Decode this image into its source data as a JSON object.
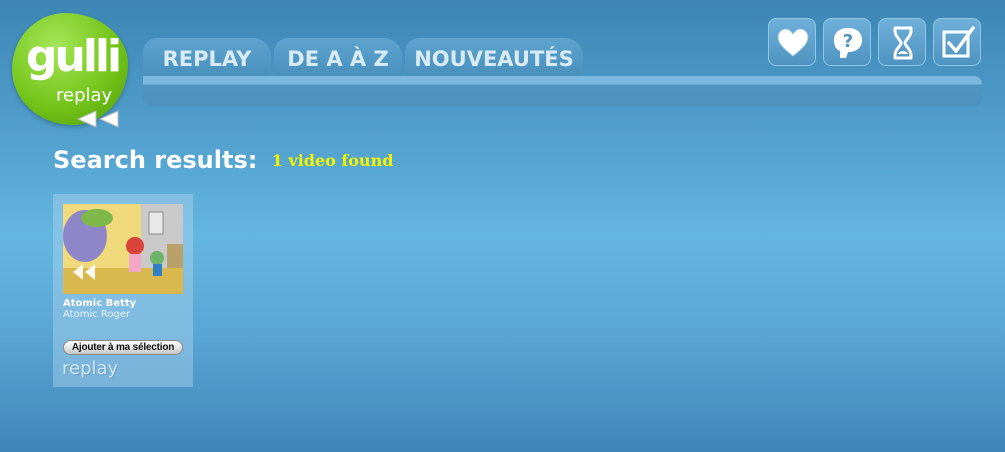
{
  "logo": {
    "main": "gulli",
    "sub": "replay"
  },
  "tabs": [
    {
      "label": "REPLAY"
    },
    {
      "label": "DE A À Z"
    },
    {
      "label": "NOUVEAUTÉS"
    }
  ],
  "toolbar_icons": [
    "heart-icon",
    "help-icon",
    "hourglass-icon",
    "checkbox-icon"
  ],
  "search": {
    "heading": "Search results:",
    "count": "1 video found"
  },
  "results": [
    {
      "show": "Atomic Betty",
      "episode": "Atomic Roger",
      "add_button": "Ajouter à ma sélection",
      "brand": "replay"
    }
  ],
  "colors": {
    "accent_green": "#74c51a",
    "count_yellow": "#f5f500"
  }
}
